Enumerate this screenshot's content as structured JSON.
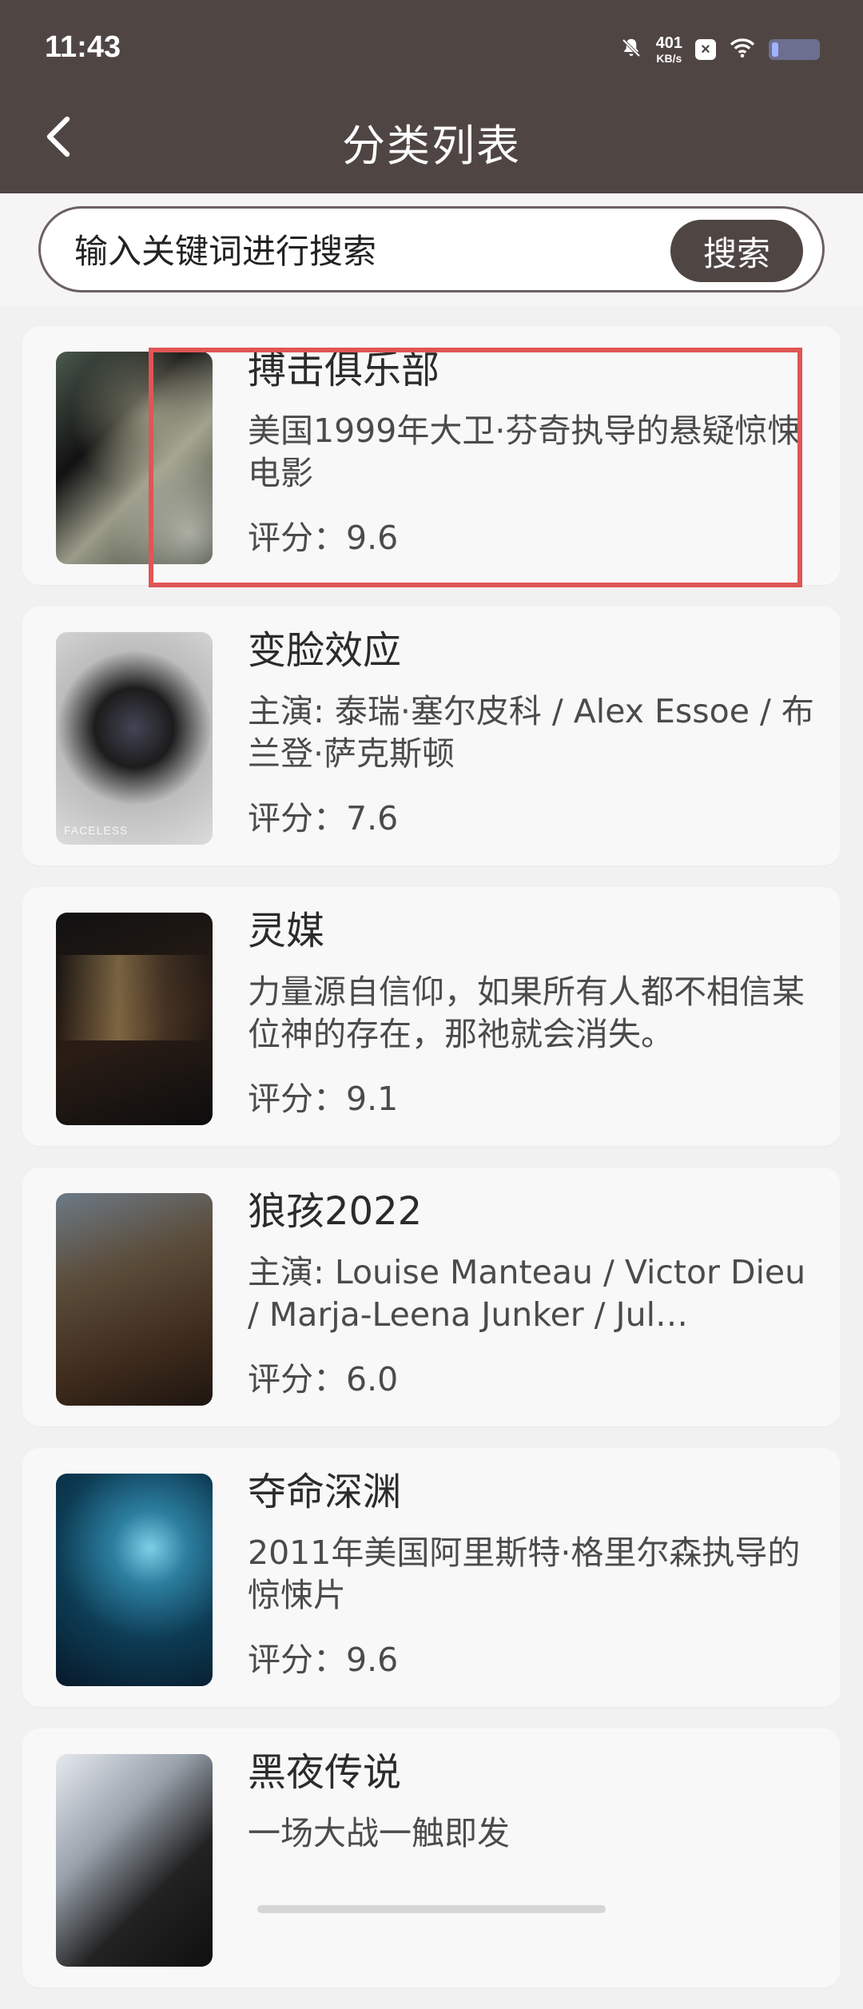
{
  "status_bar": {
    "time": "11:43",
    "net_speed_value": "401",
    "net_speed_unit": "KB/s",
    "icons": [
      "mute-icon",
      "x-icon",
      "wifi-icon",
      "battery-icon"
    ]
  },
  "header": {
    "title": "分类列表"
  },
  "search": {
    "placeholder": "输入关键词进行搜索",
    "button_label": "搜索"
  },
  "colors": {
    "header_bg": "#4f4644",
    "search_button_bg": "#4f4644",
    "highlight": "#e05555",
    "card_bg": "#f8f8f8",
    "page_bg": "#f2f1f1"
  },
  "movies": [
    {
      "title": "搏击俱乐部",
      "description": "美国1999年大卫·芬奇执导的悬疑惊悚电影",
      "rating": "评分：9.6"
    },
    {
      "title": "变脸效应",
      "description": "主演: 泰瑞·塞尔皮科 / Alex Essoe / 布兰登·萨克斯顿",
      "rating": "评分：7.6",
      "poster_text": "FACELESS"
    },
    {
      "title": "灵媒",
      "description": "力量源自信仰，如果所有人都不相信某位神的存在，那祂就会消失。",
      "rating": "评分：9.1"
    },
    {
      "title": "狼孩2022",
      "description": "主演: Louise Manteau / Victor Dieu / Marja-Leena Junker / Jul…",
      "rating": "评分：6.0"
    },
    {
      "title": "夺命深渊",
      "description": "2011年美国阿里斯特·格里尔森执导的惊悚片",
      "rating": "评分：9.6"
    },
    {
      "title": "黑夜传说",
      "description": "一场大战一触即发",
      "rating": ""
    }
  ]
}
